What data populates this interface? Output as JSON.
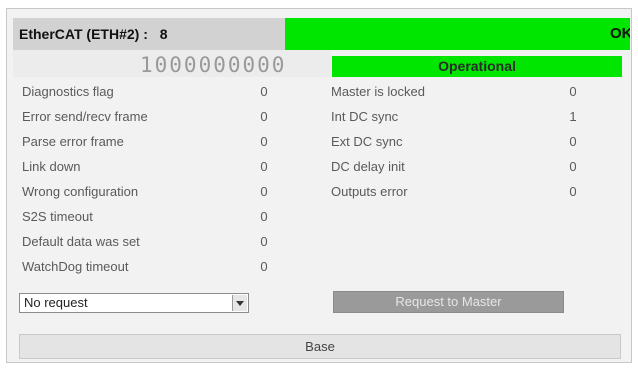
{
  "header": {
    "device_label": "EtherCAT (ETH#2) :",
    "device_count": "8",
    "status_text": "OK"
  },
  "counter": "1000000000",
  "state": "Operational",
  "left_rows": [
    {
      "label": "Diagnostics flag",
      "value": "0"
    },
    {
      "label": "Error send/recv frame",
      "value": "0"
    },
    {
      "label": "Parse error frame",
      "value": "0"
    },
    {
      "label": "Link down",
      "value": "0"
    },
    {
      "label": "Wrong configuration",
      "value": "0"
    },
    {
      "label": "S2S timeout",
      "value": "0"
    },
    {
      "label": "Default data was set",
      "value": "0"
    },
    {
      "label": "WatchDog timeout",
      "value": "0"
    }
  ],
  "right_rows": [
    {
      "label": "Master is locked",
      "value": "0"
    },
    {
      "label": "Int DC sync",
      "value": "1"
    },
    {
      "label": "Ext DC sync",
      "value": "0"
    },
    {
      "label": "DC delay init",
      "value": "0"
    },
    {
      "label": "Outputs error",
      "value": "0"
    }
  ],
  "request_select": {
    "value": "No request"
  },
  "buttons": {
    "request_master": "Request to Master",
    "base": "Base"
  },
  "colors": {
    "ok_green": "#00e600",
    "header_gray": "#d2d2d2",
    "panel_bg": "#f2f2f2"
  },
  "icons": {
    "dropdown": "chevron-down-icon"
  }
}
